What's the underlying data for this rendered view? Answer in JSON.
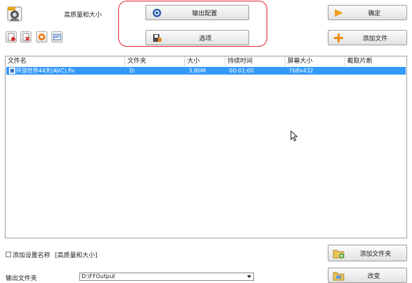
{
  "profile": {
    "title": "高质量和大小",
    "icon": "video-profile-icon"
  },
  "toolbar": {
    "output_config_label": "输出配置",
    "options_label": "选项",
    "ok_label": "确定",
    "add_file_label": "添加文件",
    "add_folder_label": "添加文件夹",
    "change_label": "改变",
    "mini_icons": [
      "clear-list-icon",
      "remove-file-icon",
      "play-icon",
      "media-info-icon"
    ]
  },
  "file_list": {
    "columns": [
      "文件名",
      "文件夹",
      "大小",
      "持续时间",
      "屏幕大小",
      "截取片断"
    ],
    "rows": [
      {
        "name": "环游世界44天(AVC).flv",
        "folder": "D:",
        "size": "3.80M",
        "duration": "00:01:00",
        "screen_size": "768x432",
        "clip": ""
      }
    ]
  },
  "bottom": {
    "add_setting_name_label": "添加设置名称",
    "add_setting_name_value": "[高质量和大小]",
    "output_folder_label": "输出文件夹",
    "output_folder_value": "D:\\FFOutput"
  },
  "colors": {
    "selection": "#3399ff",
    "highlight_border": "#e0232a"
  }
}
